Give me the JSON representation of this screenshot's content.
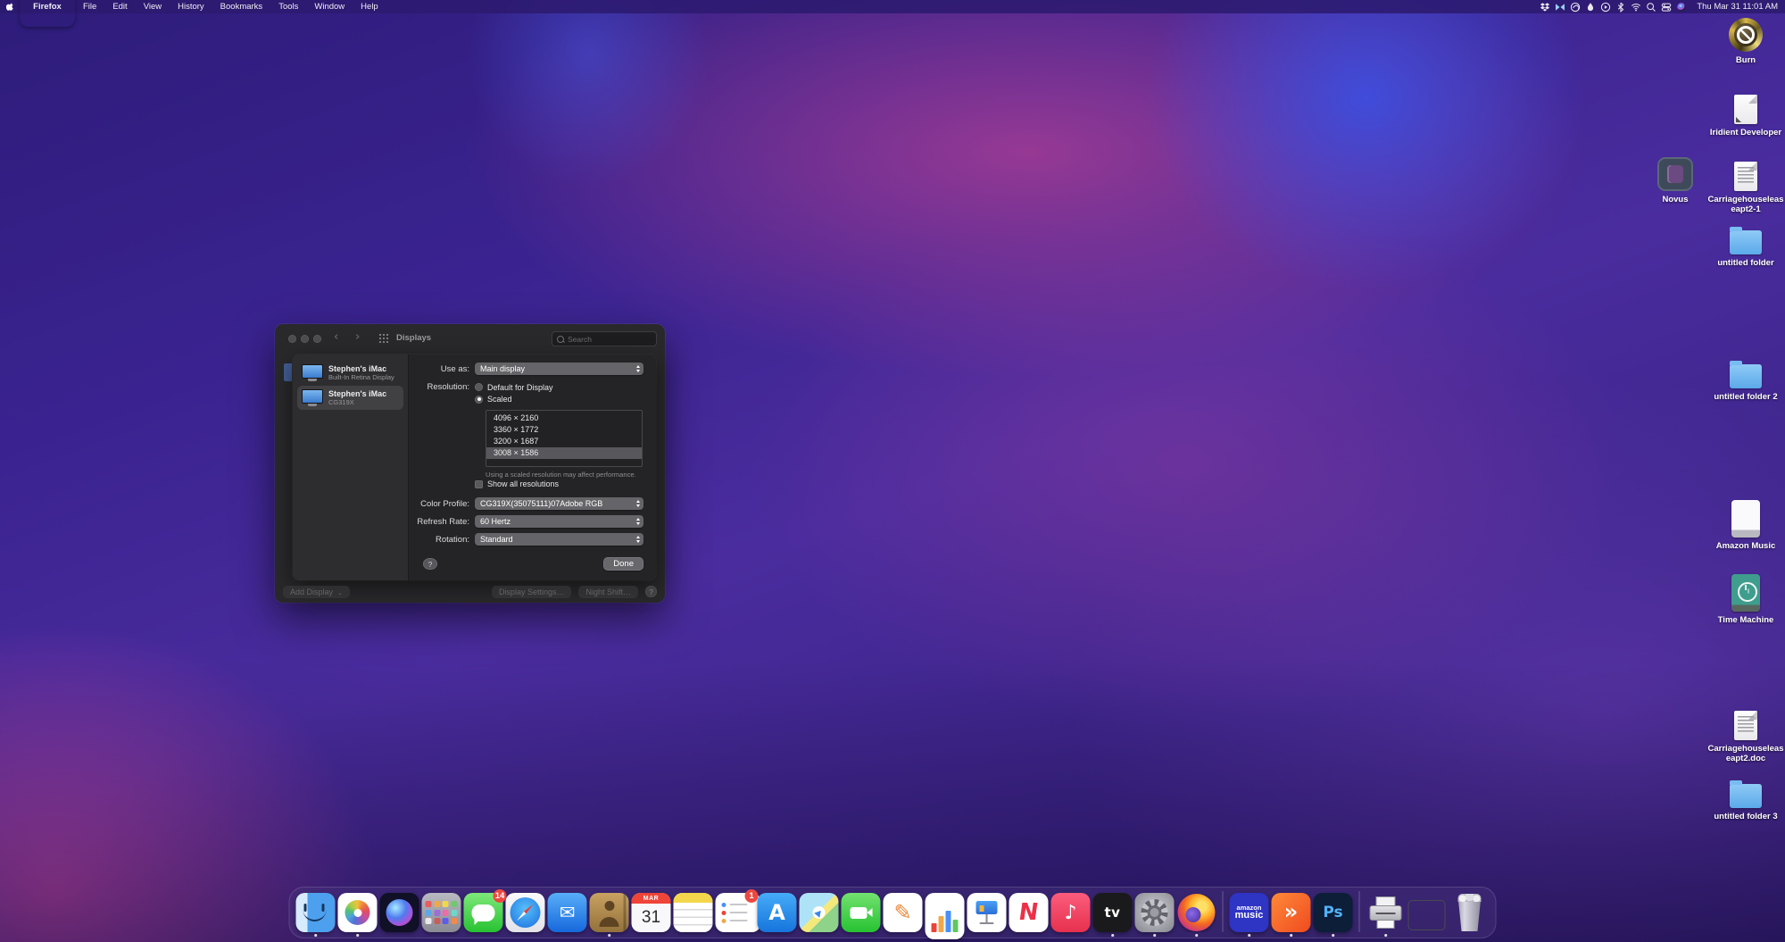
{
  "menubar": {
    "menus": [
      "Firefox",
      "File",
      "Edit",
      "View",
      "History",
      "Bookmarks",
      "Tools",
      "Window",
      "Help"
    ],
    "status_icons": [
      "dropbox",
      "butterfly",
      "creative-cloud",
      "droplet",
      "play-circle",
      "bluetooth",
      "wifi",
      "spotlight",
      "control-center",
      "siri"
    ],
    "clock": "Thu Mar 31 11:01 AM"
  },
  "window": {
    "title": "Displays",
    "search_placeholder": "Search",
    "sidebar": [
      {
        "name": "Stephen's iMac",
        "subtitle": "Built-In Retina Display",
        "selected": false
      },
      {
        "name": "Stephen's iMac",
        "subtitle": "CG319X",
        "selected": true
      }
    ],
    "form": {
      "use_as_label": "Use as:",
      "use_as_value": "Main display",
      "resolution_label": "Resolution:",
      "radio_default": "Default for Display",
      "radio_scaled": "Scaled",
      "scaled_selected": true,
      "resolutions": [
        "4096 × 2160",
        "3360 × 1772",
        "3200 × 1687",
        "3008 × 1586"
      ],
      "selected_resolution": "3008 × 1586",
      "note": "Using a scaled resolution may affect performance.",
      "show_all_label": "Show all resolutions",
      "show_all_checked": false,
      "color_profile_label": "Color Profile:",
      "color_profile_value": "CG319X(35075111)07Adobe RGB",
      "refresh_rate_label": "Refresh Rate:",
      "refresh_rate_value": "60 Hertz",
      "rotation_label": "Rotation:",
      "rotation_value": "Standard",
      "help_button": "?",
      "done_button": "Done"
    },
    "bottom_bar": {
      "add_display": "Add Display",
      "display_settings": "Display Settings…",
      "night_shift": "Night Shift…",
      "help": "?"
    }
  },
  "desktop_icons": [
    {
      "id": "burn",
      "lines": [
        "Burn"
      ]
    },
    {
      "id": "iridient",
      "lines": [
        "Iridient Developer"
      ]
    },
    {
      "id": "novus",
      "lines": [
        "Novus"
      ]
    },
    {
      "id": "carriage1",
      "lines": [
        "Carriagehouseleas",
        "eapt2-1"
      ]
    },
    {
      "id": "folder1",
      "lines": [
        "untitled folder"
      ]
    },
    {
      "id": "folder2",
      "lines": [
        "untitled folder 2"
      ]
    },
    {
      "id": "amazondrive",
      "lines": [
        "Amazon Music"
      ]
    },
    {
      "id": "timemachine",
      "lines": [
        "Time Machine"
      ]
    },
    {
      "id": "carriage2",
      "lines": [
        "Carriagehouseleas",
        "eapt2.doc"
      ]
    },
    {
      "id": "folder3",
      "lines": [
        "untitled folder 3"
      ]
    }
  ],
  "dock": {
    "items": [
      {
        "id": "finder",
        "label": "Finder",
        "dot": true
      },
      {
        "id": "photos",
        "label": "Photos",
        "dot": true
      },
      {
        "id": "siri",
        "label": "Siri"
      },
      {
        "id": "launchpad",
        "label": "Launchpad"
      },
      {
        "id": "messages",
        "label": "Messages",
        "badge": "14"
      },
      {
        "id": "safari",
        "label": "Safari"
      },
      {
        "id": "mail",
        "label": "Mail"
      },
      {
        "id": "contacts",
        "label": "Contacts",
        "dot": true
      },
      {
        "id": "calendar",
        "label": "Calendar"
      },
      {
        "id": "notes",
        "label": "Notes"
      },
      {
        "id": "reminders",
        "label": "Reminders",
        "badge": "1"
      },
      {
        "id": "appstore",
        "label": "App Store"
      },
      {
        "id": "maps",
        "label": "Maps"
      },
      {
        "id": "facetime",
        "label": "FaceTime"
      },
      {
        "id": "pages",
        "label": "Pages"
      },
      {
        "id": "numbers",
        "label": "Numbers"
      },
      {
        "id": "keynote",
        "label": "Keynote"
      },
      {
        "id": "news",
        "label": "News"
      },
      {
        "id": "music",
        "label": "Music"
      },
      {
        "id": "appletv",
        "label": "Apple TV",
        "dot": true
      },
      {
        "id": "sysprefs",
        "label": "System Preferences",
        "dot": true
      },
      {
        "id": "firefox",
        "label": "Firefox",
        "dot": true
      },
      {
        "sep": true
      },
      {
        "id": "amazonmusic",
        "label": "Amazon Music",
        "dot": true
      },
      {
        "id": "orangeapp",
        "label": "Orange arrows app",
        "dot": true
      },
      {
        "id": "photoshop",
        "label": "Photoshop",
        "dot": true
      },
      {
        "sep": true
      },
      {
        "id": "printer",
        "label": "Printer",
        "dot": true
      },
      {
        "id": "minwindow",
        "label": "Minimized Firefox window"
      },
      {
        "id": "trash",
        "label": "Trash"
      }
    ],
    "calendar": {
      "month": "MAR",
      "day": "31"
    },
    "amazon_music_lines": [
      "amazon",
      "music"
    ],
    "photoshop_text": "Ps",
    "appletv_text": "tv",
    "news_letter": "N"
  },
  "colors": {
    "badge": "#ec4840",
    "menubar_tint": "#2c1a70",
    "accent_blue": "#3a7ccf"
  }
}
